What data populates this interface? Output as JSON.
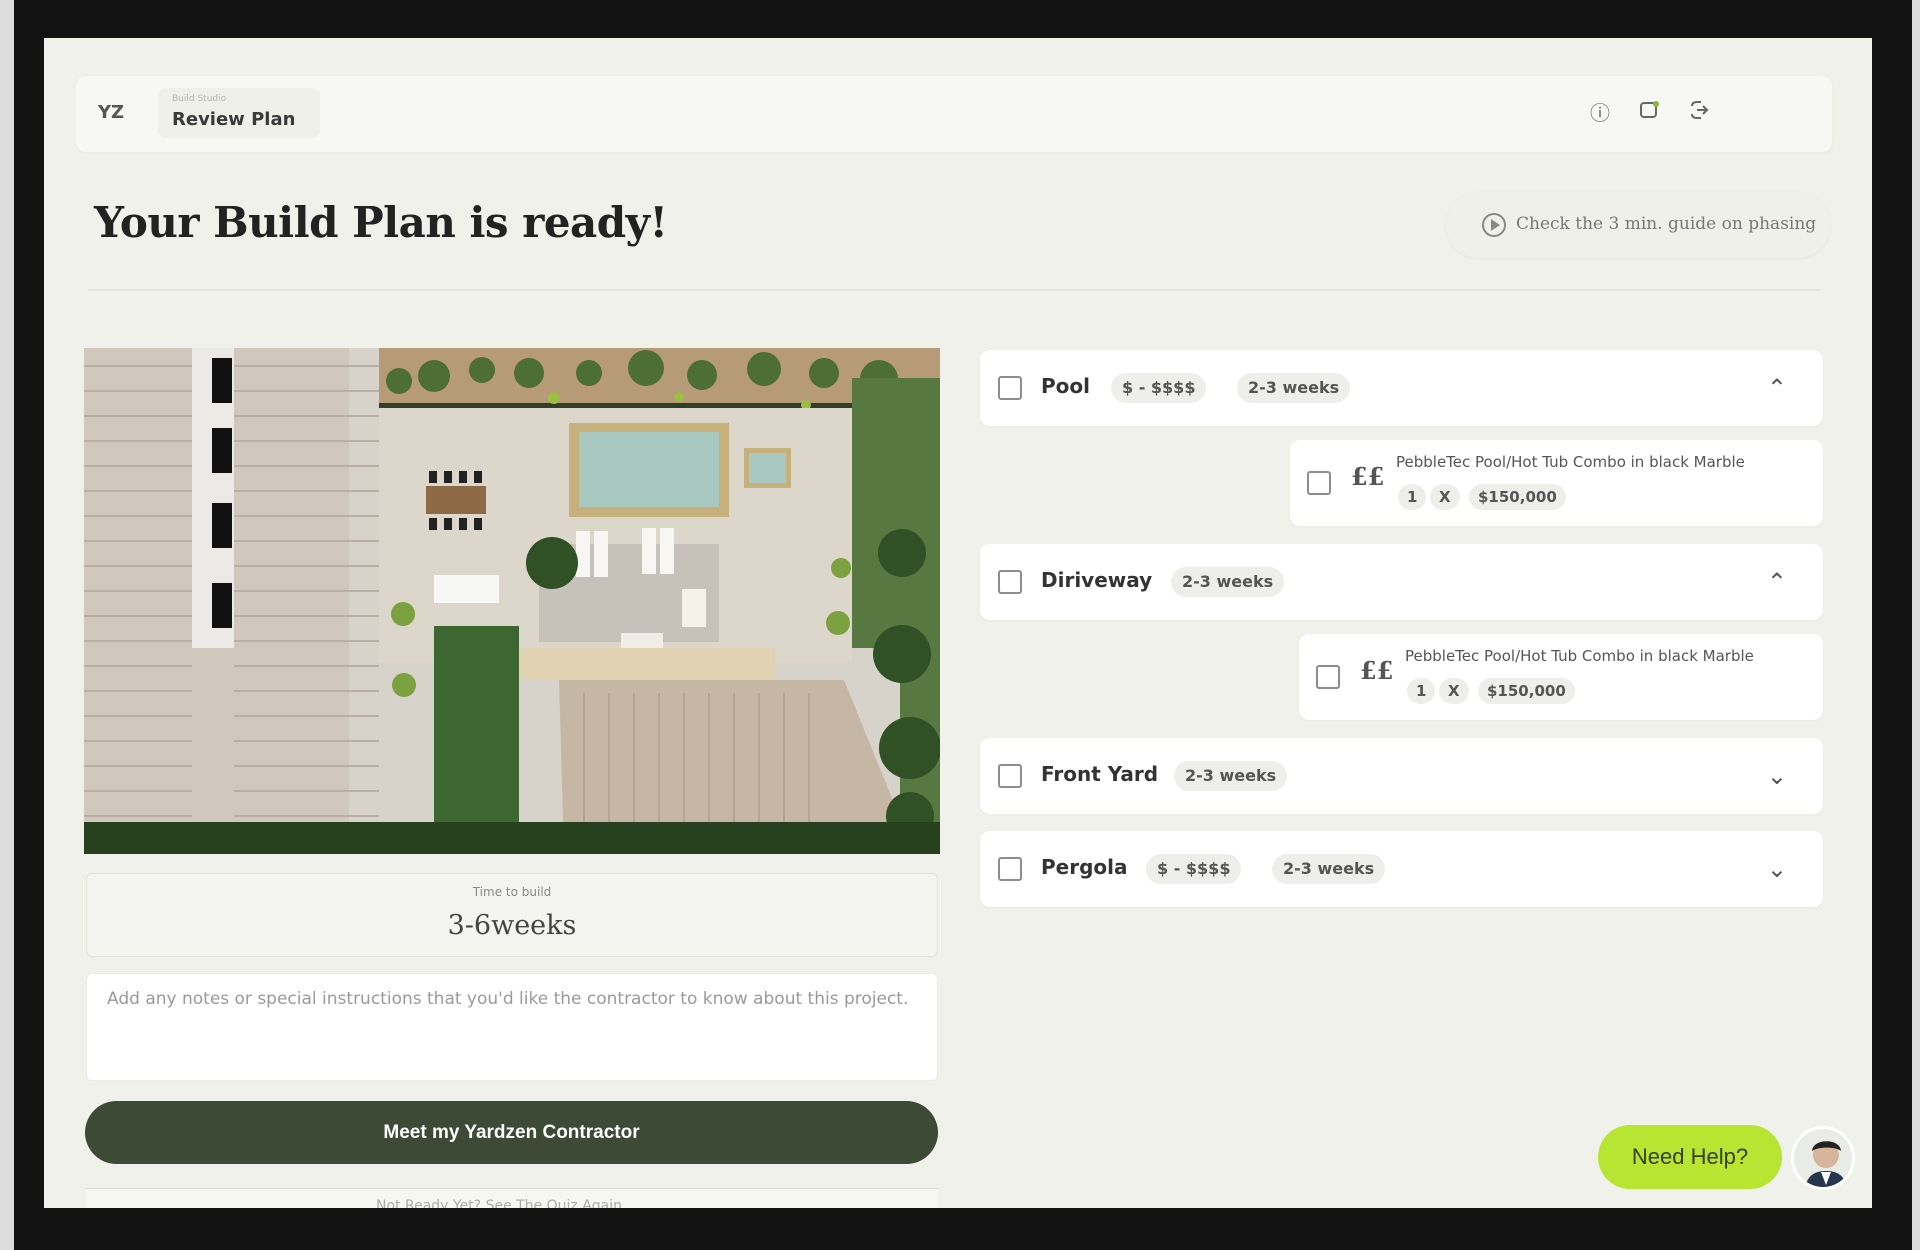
{
  "app": {
    "logo": "YZ",
    "breadcrumb_small": "Build Studio",
    "breadcrumb_title": "Review Plan"
  },
  "icons": {
    "help": "help-circle-icon",
    "notifications": "notifications-icon",
    "logout": "logout-icon",
    "guide": "play-icon"
  },
  "page": {
    "title": "Your Build Plan is ready!",
    "guide_text": "Check the 3 min. guide on phasing"
  },
  "left": {
    "time_label": "Time to build",
    "time_value": "3-6weeks",
    "notes_placeholder": "Add any notes or special instructions that you'd like the contractor to know about this project.",
    "cta_label": "Meet my Yardzen Contractor",
    "footer_partial": "Not Ready Yet? See The Quiz Again"
  },
  "plan_items": [
    {
      "name": "Pool",
      "tags": [
        "$ - $$$$",
        "2-3 weeks"
      ],
      "expanded": true
    },
    {
      "name": "Diriveway",
      "tags": [
        "2-3 weeks"
      ],
      "expanded": true
    },
    {
      "name": "Front Yard",
      "tags": [
        "2-3 weeks"
      ],
      "expanded": false
    },
    {
      "name": "Pergola",
      "tags": [
        "$ - $$$$",
        "2-3 weeks"
      ],
      "expanded": false
    }
  ],
  "sub_items": [
    {
      "icon": "££",
      "title": "PebbleTec Pool/Hot Tub Combo in black Marble",
      "qty": "1",
      "sep": "X",
      "price": "$150,000"
    },
    {
      "icon": "££",
      "title": "PebbleTec Pool/Hot Tub Combo in black Marble",
      "qty": "1",
      "sep": "X",
      "price": "$150,000"
    }
  ],
  "support": {
    "help_label": "Need Help?"
  },
  "colors": {
    "background": "#f1f1ec",
    "card": "#ffffff",
    "cta": "#3d4a36",
    "help": "#b7e531",
    "tag": "#eeeeea"
  }
}
